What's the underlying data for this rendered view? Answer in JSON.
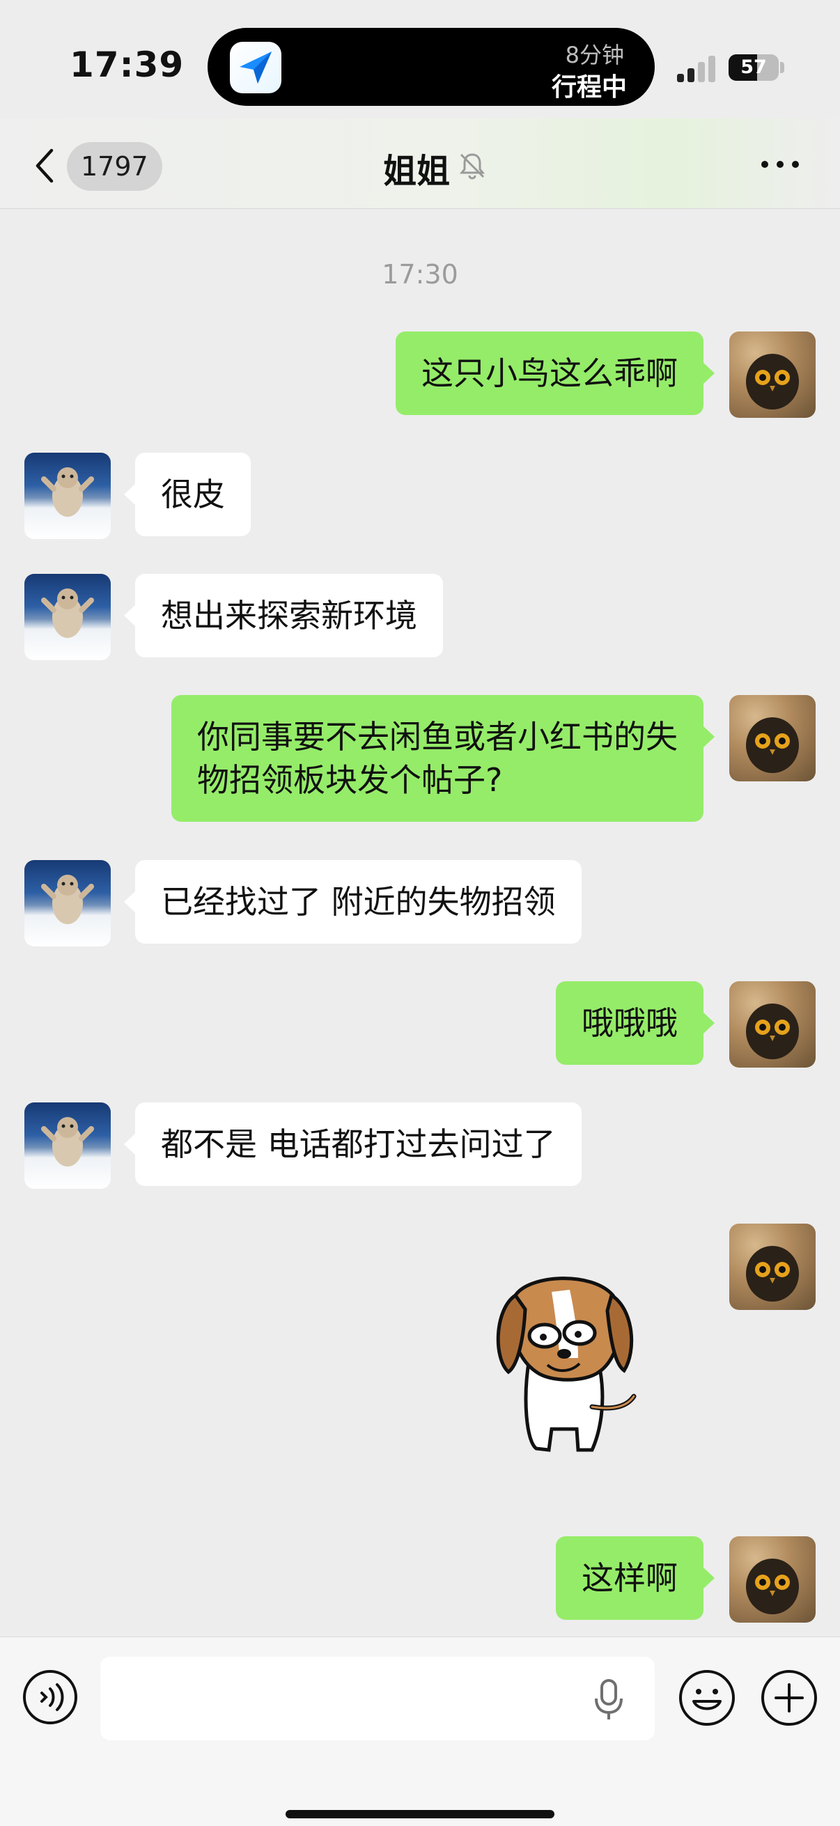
{
  "status_bar": {
    "time": "17:39",
    "island_eta": "8分钟",
    "island_status": "行程中",
    "island_app_icon": "paper-plane-icon",
    "battery_level": "57"
  },
  "header": {
    "unread_count": "1797",
    "title": "姐姐",
    "muted": true
  },
  "chat": {
    "timestamp": "17:30",
    "messages": [
      {
        "side": "out",
        "type": "text",
        "text": "这只小鸟这么乖啊"
      },
      {
        "side": "in",
        "type": "text",
        "text": "很皮"
      },
      {
        "side": "in",
        "type": "text",
        "text": "想出来探索新环境"
      },
      {
        "side": "out",
        "type": "text",
        "text": "你同事要不去闲鱼或者小红书的失\n物招领板块发个帖子?"
      },
      {
        "side": "in",
        "type": "text",
        "text": "已经找过了 附近的失物招领"
      },
      {
        "side": "out",
        "type": "text",
        "text": "哦哦哦"
      },
      {
        "side": "in",
        "type": "text",
        "text": "都不是 电话都打过去问过了"
      },
      {
        "side": "out",
        "type": "sticker",
        "sticker": "beagle-dog-sticker"
      },
      {
        "side": "out",
        "type": "text",
        "text": "这样啊"
      }
    ]
  },
  "input_bar": {
    "placeholder": "",
    "icons": [
      "voice-icon",
      "microphone-icon",
      "emoji-icon",
      "plus-icon"
    ]
  },
  "colors": {
    "background": "#ededed",
    "outgoing_bubble": "#95ec69",
    "incoming_bubble": "#ffffff",
    "timestamp": "#9b9b9b"
  }
}
